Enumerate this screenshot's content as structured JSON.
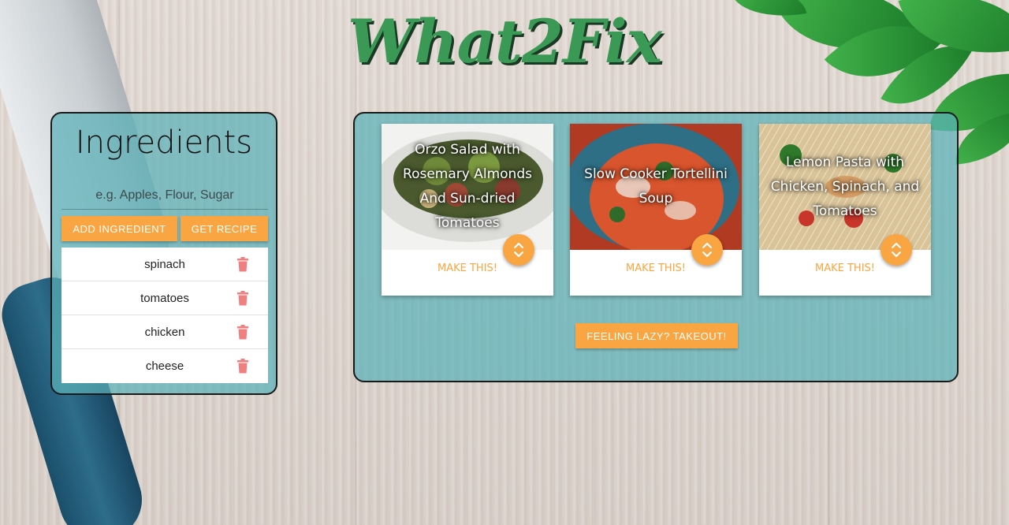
{
  "app": {
    "title": "What2Fix"
  },
  "ingredients_panel": {
    "heading": "Ingredients",
    "input_placeholder": "e.g. Apples, Flour, Sugar",
    "add_label": "ADD INGREDIENT",
    "get_label": "GET RECIPE",
    "items": [
      {
        "label": "spinach"
      },
      {
        "label": "tomatoes"
      },
      {
        "label": "chicken"
      },
      {
        "label": "cheese"
      }
    ]
  },
  "recipes_panel": {
    "cards": [
      {
        "title": "Orzo Salad with Rosemary Almonds And Sun-dried Tomatoes",
        "action": "MAKE THIS!"
      },
      {
        "title": "Slow Cooker Tortellini Soup",
        "action": "MAKE THIS!"
      },
      {
        "title": "Lemon Pasta with Chicken, Spinach, and Tomatoes",
        "action": "MAKE THIS!"
      }
    ],
    "takeout_label": "FEELING LAZY? TAKEOUT!"
  },
  "icons": {
    "trash": "trash-icon",
    "expand": "unfold-icon"
  },
  "colors": {
    "accent": "#f9a541",
    "panel": "#5ab2b9",
    "title_green": "#3a9a55",
    "trash": "#f08080"
  }
}
